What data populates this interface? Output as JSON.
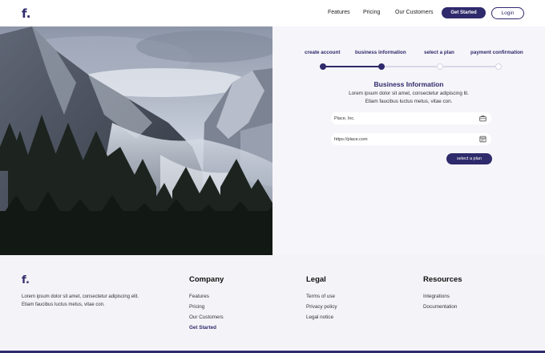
{
  "nav": {
    "logo": "f.",
    "links": [
      "Features",
      "Pricing",
      "Our Customers"
    ],
    "get_started": "Get Started",
    "login": "Login"
  },
  "steps": {
    "labels": [
      "create account",
      "business information",
      "select a plan",
      "payment confirmation"
    ],
    "completed_count": 2,
    "accent": "#2f2a6b"
  },
  "form": {
    "title": "Business Information",
    "desc_line1": "Lorem ipsum dolor sit amet, consectetur adipiscing lit.",
    "desc_line2": "Etiam faucibus luctus metus, vitae con.",
    "company_value": "Place, Inc.",
    "company_icon": "briefcase-icon",
    "website_value": "https://place.com",
    "website_icon": "browser-window-icon",
    "next_button": "select a plan"
  },
  "footer": {
    "logo": "f.",
    "about": "Lorem ipsum dolor sit amet, consectetur adipiscing elit. Etiam faucibus luctus metus, vitae con.",
    "columns": [
      {
        "title": "Company",
        "links": [
          "Features",
          "Pricing",
          "Our Customers",
          "Get Started"
        ]
      },
      {
        "title": "Legal",
        "links": [
          "Terms of use",
          "Privacy policy",
          "Legal notice"
        ]
      },
      {
        "title": "Resources",
        "links": [
          "Integrations",
          "Documentation"
        ]
      }
    ]
  }
}
